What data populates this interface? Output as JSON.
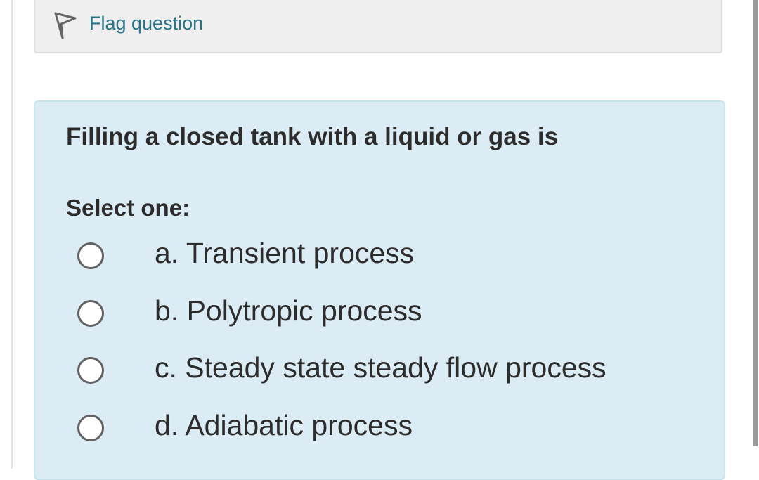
{
  "flag": {
    "icon": "flag-outline-icon",
    "label": "Flag question"
  },
  "question": {
    "text": "Filling a closed tank with a liquid or gas is",
    "prompt": "Select one:",
    "options": [
      {
        "label": "a. Transient process",
        "selected": false
      },
      {
        "label": "b. Polytropic process",
        "selected": false
      },
      {
        "label": "c. Steady state steady flow process",
        "selected": false
      },
      {
        "label": "d. Adiabatic process",
        "selected": false
      }
    ]
  },
  "colors": {
    "flag_text": "#2a7488",
    "question_bg": "#dcecf5",
    "flag_bg": "#efefef",
    "text": "#2c2c2c"
  }
}
